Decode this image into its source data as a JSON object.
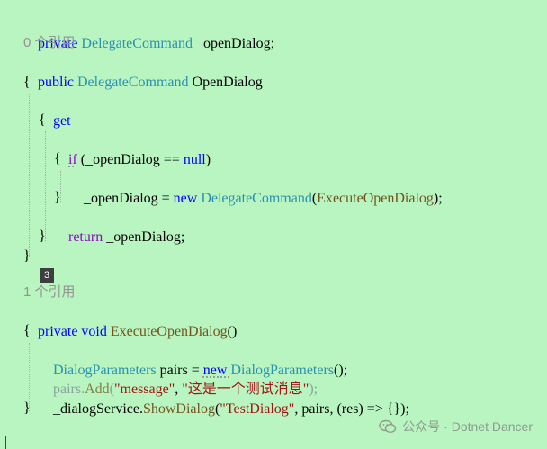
{
  "lines": {
    "l1": {
      "kw": "private ",
      "type": "DelegateCommand",
      "rest": " _openDialog;"
    },
    "l2": {
      "refs": "0 个引用"
    },
    "l3": {
      "kw": "public ",
      "type": "DelegateCommand",
      "rest": " OpenDialog"
    },
    "l4": {
      "text": "{"
    },
    "l5": {
      "kw": "get"
    },
    "l6": {
      "text": "{"
    },
    "l7": {
      "kw": "if",
      "p1": " (_openDialog == ",
      "kw2": "null",
      "p2": ")"
    },
    "l8": {
      "text": "{"
    },
    "l9": {
      "p1": "_openDialog = ",
      "kw": "new ",
      "type": "DelegateCommand",
      "p2": "(",
      "fn": "ExecuteOpenDialog",
      "p3": ");"
    },
    "l10": {
      "text": "}"
    },
    "l11": {
      "kw": "return",
      "rest": " _openDialog;"
    },
    "l12": {
      "text": "}"
    },
    "l13": {
      "text": "}"
    },
    "l14": {
      "refs": "1 个引用"
    },
    "l15": {
      "kw": "private void ",
      "fn": "ExecuteOpenDialog",
      "rest": "()"
    },
    "l16": {
      "text": "{"
    },
    "l17": {
      "type": "DialogParameters",
      "p1": " pairs = ",
      "kw": "new ",
      "type2": "DialogParameters",
      "p2": "();"
    },
    "l18": {
      "p1": "pairs.",
      "fn": "Add",
      "p2": "(",
      "s1": "\"message\"",
      "p3": ", ",
      "s2": "\"这是一个测试消息\"",
      "p4": ");"
    },
    "l19": {
      "p1": "_dialogService.",
      "fn": "ShowDialog",
      "p2": "(",
      "s1": "\"TestDialog\"",
      "p3": ", pairs, (res) => {});"
    },
    "l20": {
      "text": "}"
    }
  },
  "badge": "3",
  "watermark": "公众号 · Dotnet Dancer",
  "colors": {
    "background": "#b9f5c0",
    "keyword": "#0000ff",
    "control_keyword": "#8f08c4",
    "type": "#2b91af",
    "method": "#74531f",
    "string": "#a31515",
    "codelens": "#939393"
  }
}
